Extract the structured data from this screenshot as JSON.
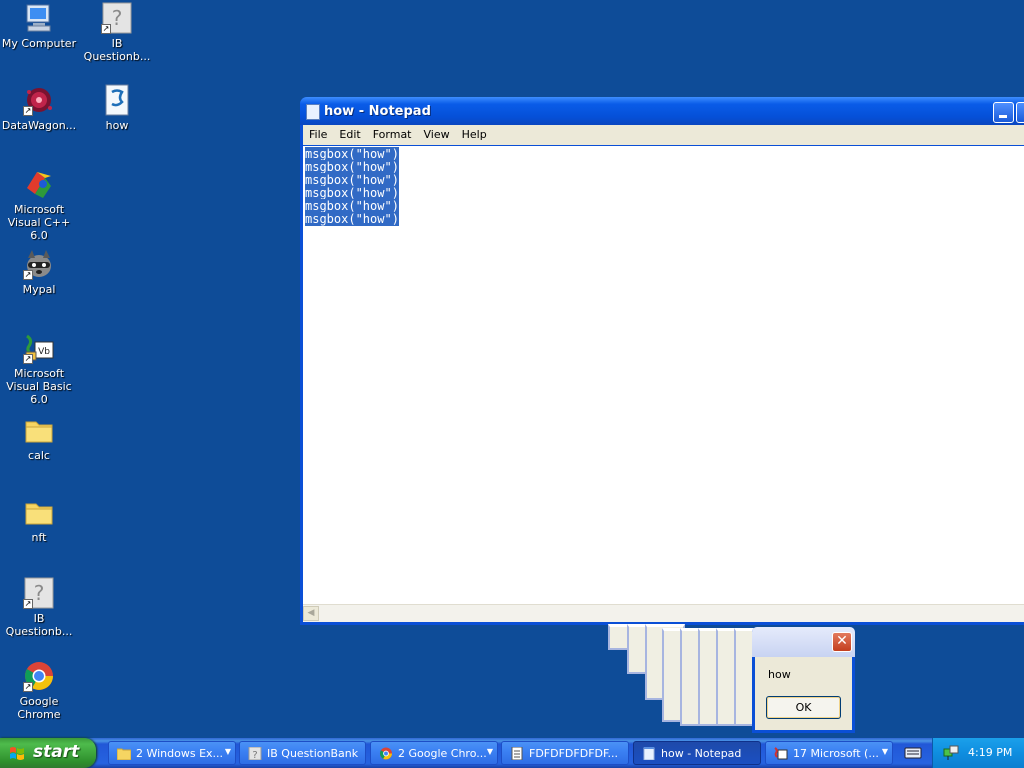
{
  "desktop_icons": [
    {
      "label": "My Computer"
    },
    {
      "label": "IB Questionb..."
    },
    {
      "label": "DataWagon..."
    },
    {
      "label": "how"
    },
    {
      "label": "Microsoft Visual C++ 6.0"
    },
    {
      "label": "Mypal"
    },
    {
      "label": "Microsoft Visual Basic 6.0"
    },
    {
      "label": "calc"
    },
    {
      "label": "nft"
    },
    {
      "label": "IB Questionb..."
    },
    {
      "label": "Google Chrome"
    }
  ],
  "notepad": {
    "title": "how - Notepad",
    "menu": [
      "File",
      "Edit",
      "Format",
      "View",
      "Help"
    ],
    "lines": [
      "msgbox(\"how\")",
      "msgbox(\"how\")",
      "msgbox(\"how\")",
      "msgbox(\"how\")",
      "msgbox(\"how\")",
      "msgbox(\"how\")"
    ]
  },
  "msgbox": {
    "message": "how",
    "ok_label": "OK",
    "close_glyph": "✕",
    "stack_count": 8
  },
  "taskbar": {
    "start_label": "start",
    "tasks": [
      {
        "label": "2 Windows Ex...",
        "icon": "folder-icon",
        "grouped": true
      },
      {
        "label": "IB QuestionBank",
        "icon": "app-icon",
        "grouped": false
      },
      {
        "label": "2 Google Chro...",
        "icon": "chrome-icon",
        "grouped": true
      },
      {
        "label": "FDFDFDFDFDF...",
        "icon": "document-icon",
        "grouped": false
      },
      {
        "label": "how - Notepad",
        "icon": "notepad-icon",
        "grouped": false,
        "active": true
      },
      {
        "label": "17 Microsoft (...",
        "icon": "vb-icon",
        "grouped": true
      }
    ],
    "clock": "4:19 PM"
  },
  "colors": {
    "desktop": "#0e4c98",
    "selection": "#316ac5",
    "taskbar": "#2663e0",
    "start": "#3c9a3a",
    "tray": "#0f8ee0"
  }
}
